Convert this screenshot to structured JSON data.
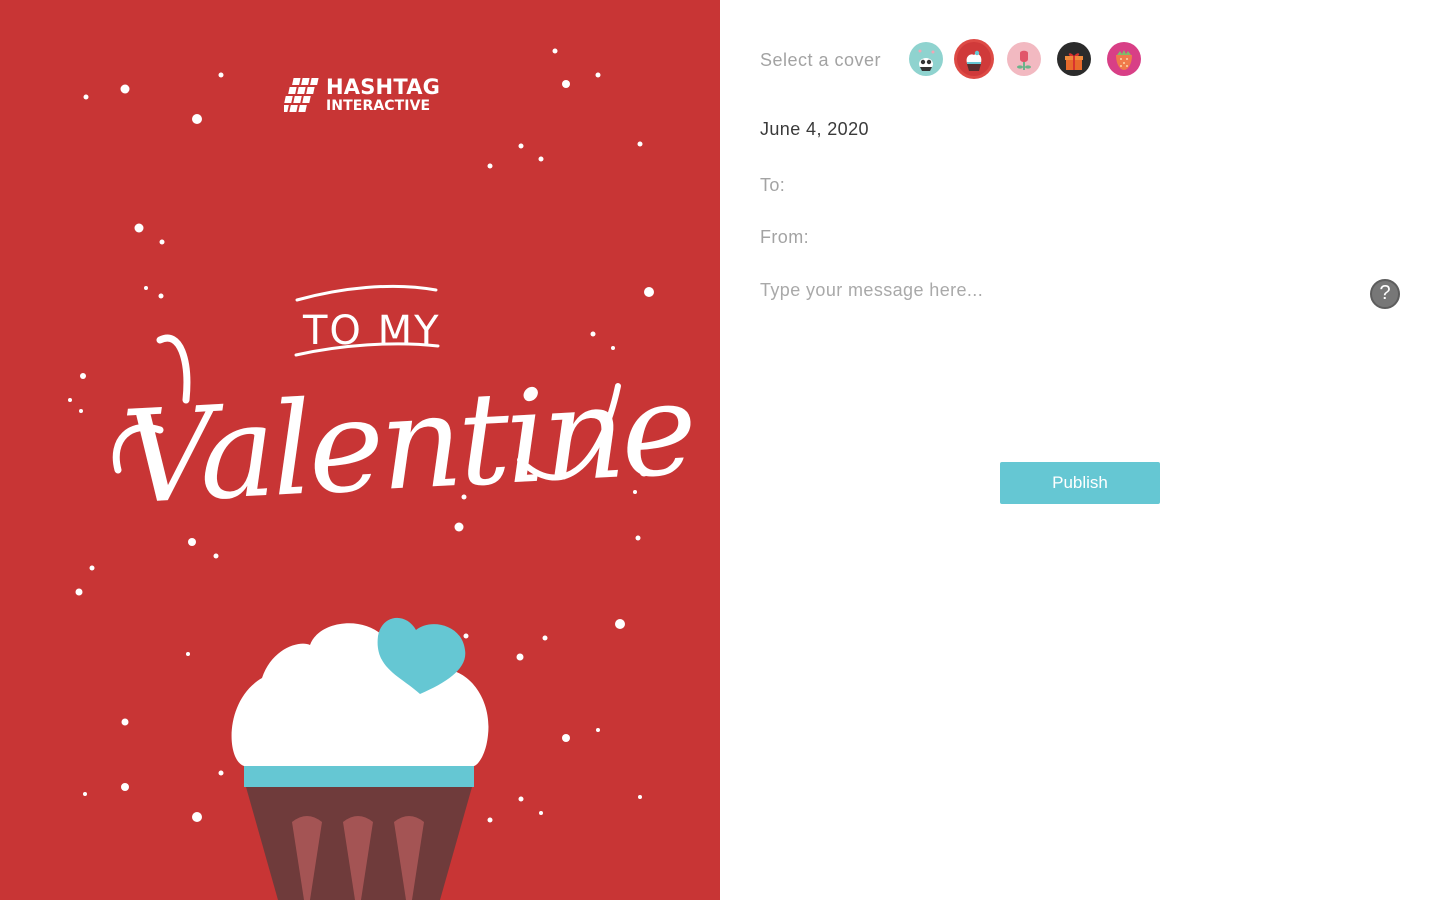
{
  "card": {
    "logo_line1": "HASHTAG",
    "logo_line2": "INTERACTIVE",
    "greeting_small": "TO MY",
    "greeting_large": "Valentine",
    "background_color": "#c83535",
    "accent_color": "#65c7d3"
  },
  "form": {
    "cover_label": "Select a cover",
    "covers": [
      {
        "name": "owl-cover-icon",
        "color": "#8fd3cf"
      },
      {
        "name": "cupcake-cover-icon",
        "color": "#d03a3a",
        "selected": true
      },
      {
        "name": "rose-cover-icon",
        "color": "#f2b9c1"
      },
      {
        "name": "gift-cover-icon",
        "color": "#2b2b2b"
      },
      {
        "name": "strawberry-cover-icon",
        "color": "#d83f86"
      }
    ],
    "date": "June 4, 2020",
    "to_label": "To:",
    "from_label": "From:",
    "message_placeholder": "Type your message here...",
    "help_symbol": "?",
    "publish_label": "Publish"
  }
}
